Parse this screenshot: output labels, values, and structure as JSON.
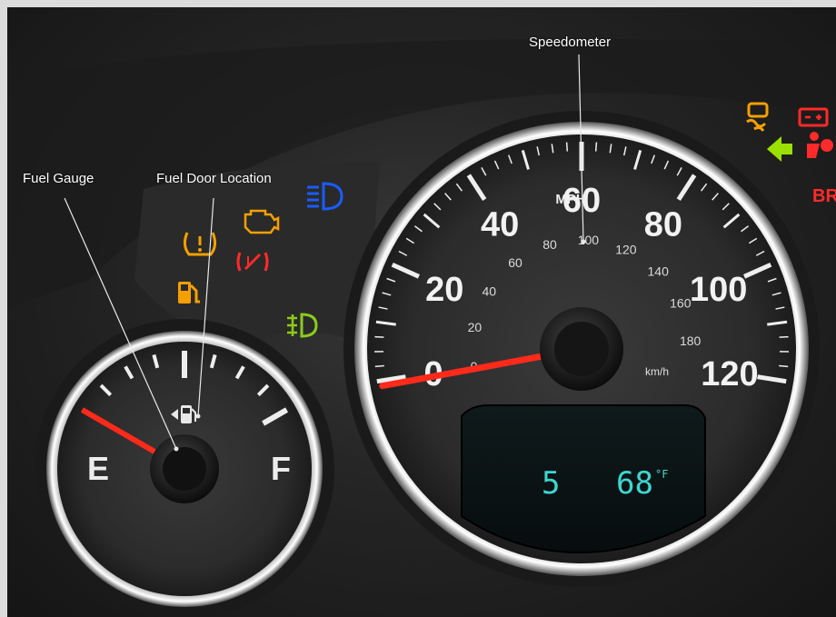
{
  "callouts": {
    "fuel_gauge": "Fuel Gauge",
    "fuel_door": "Fuel Door Location",
    "speedometer": "Speedometer"
  },
  "speedometer": {
    "mph_labels": [
      "0",
      "20",
      "40",
      "60",
      "80",
      "100",
      "120"
    ],
    "mph_unit": "MPH",
    "kmh_labels": [
      "0",
      "20",
      "40",
      "60",
      "80",
      "100",
      "120",
      "140",
      "160",
      "180"
    ],
    "kmh_unit": "km/h",
    "needle_mph": 0
  },
  "fuel_gauge": {
    "empty_label": "E",
    "full_label": "F",
    "level": 0.0
  },
  "display": {
    "gear": "5",
    "temperature": "68",
    "temperature_unit": "°F"
  },
  "warning_lights": {
    "brake_text": "BR"
  },
  "colors": {
    "needle": "#ff2a1a",
    "lcd_text": "#3fd6d0",
    "amber": "#f5a000",
    "red": "#ff2a2a",
    "blue": "#1a5cff",
    "green": "#8ccc1a",
    "callout_line": "#e8e8e8"
  }
}
